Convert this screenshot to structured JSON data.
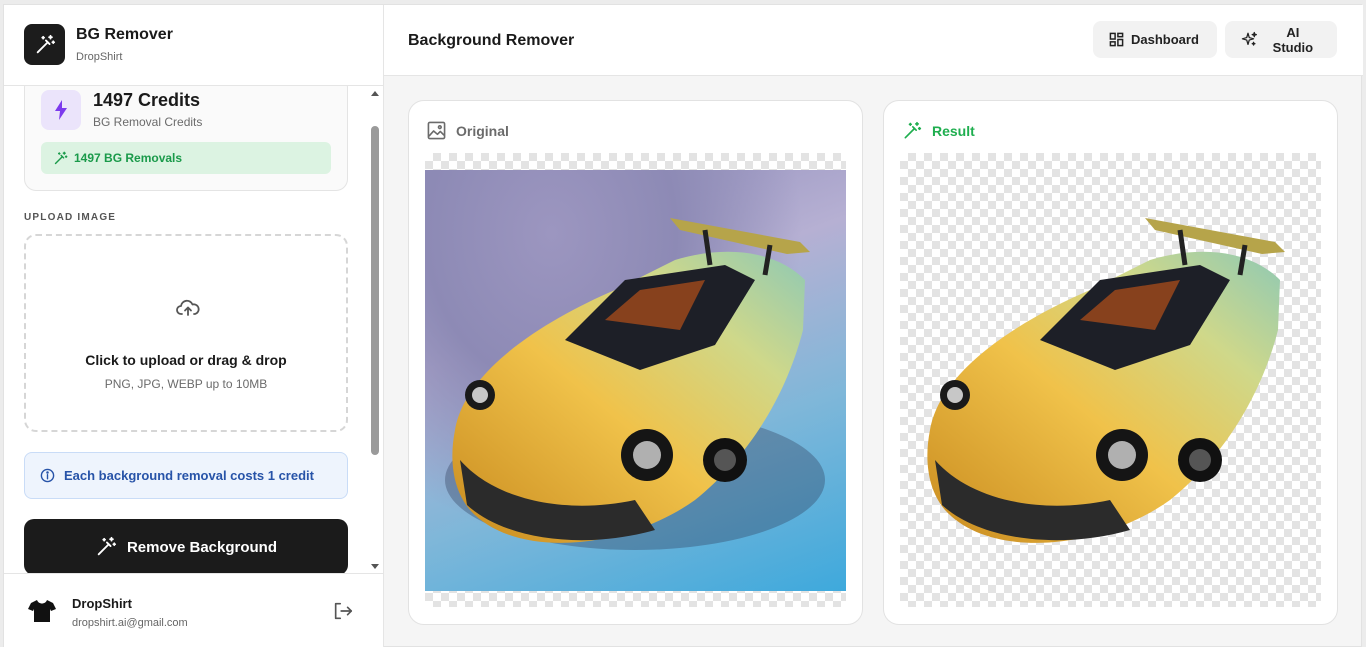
{
  "brand": {
    "title": "BG Remover",
    "subtitle": "DropShirt"
  },
  "credits": {
    "value": "1497 Credits",
    "label": "BG Removal Credits",
    "removals": "1497 BG Removals"
  },
  "upload": {
    "section_label": "UPLOAD IMAGE",
    "title": "Click to upload or drag & drop",
    "hint": "PNG, JPG, WEBP up to 10MB"
  },
  "info": {
    "text": "Each background removal costs 1 credit"
  },
  "actions": {
    "remove_background": "Remove Background"
  },
  "user": {
    "name": "DropShirt",
    "email": "dropshirt.ai@gmail.com"
  },
  "header": {
    "title": "Background Remover",
    "dashboard": "Dashboard",
    "ai_studio": "AI Studio"
  },
  "panels": {
    "original": "Original",
    "result": "Result"
  },
  "colors": {
    "accent_green": "#1fae4f",
    "accent_purple": "#7c3aed",
    "dark": "#1b1b1b",
    "info_blue": "#2753a8"
  },
  "icons": {
    "brand": "magic-wand-icon",
    "credits": "lightning-bolt-icon",
    "upload": "cloud-upload-icon",
    "info": "info-circle-icon",
    "user": "tshirt-icon",
    "logout": "logout-icon",
    "dashboard": "grid-icon",
    "studio": "sparkles-icon",
    "original": "image-icon"
  }
}
